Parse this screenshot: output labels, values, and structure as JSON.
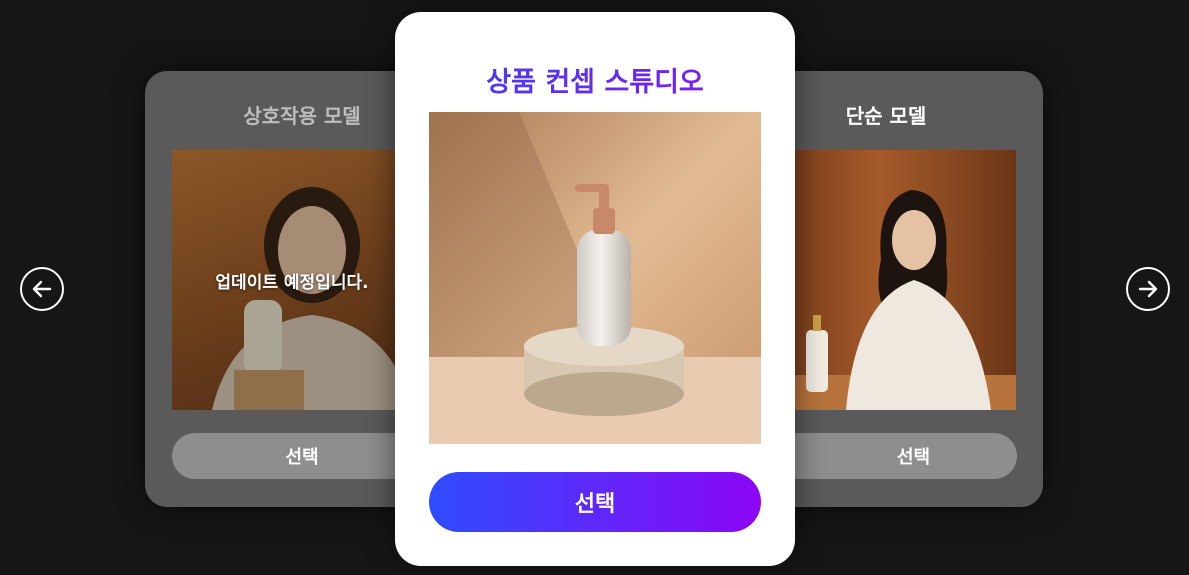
{
  "carousel": {
    "left_card": {
      "title": "상호작용 모델",
      "notice": "업데이트 예정입니다.",
      "select_label": "선택"
    },
    "center_card": {
      "title": "상품 컨셉 스튜디오",
      "select_label": "선택"
    },
    "right_card": {
      "title": "단순 모델",
      "select_label": "선택"
    }
  },
  "nav": {
    "prev_icon": "arrow-left-icon",
    "next_icon": "arrow-right-icon"
  },
  "colors": {
    "background": "#161616",
    "side_card": "#5a5a5a",
    "side_button": "#8e8e8e",
    "gradient_start": "#2f4cff",
    "gradient_end": "#8c05f5"
  }
}
